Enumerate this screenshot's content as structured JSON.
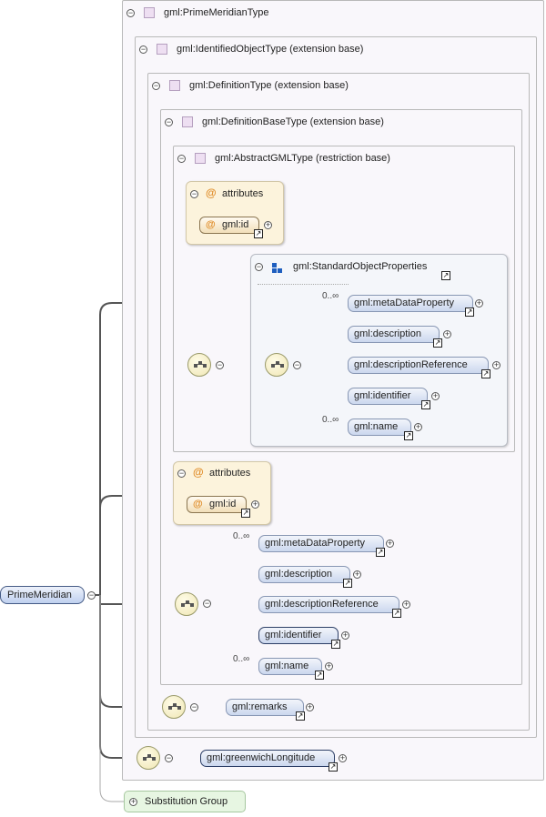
{
  "types": {
    "prime_meridian_type": "gml:PrimeMeridianType",
    "identified_object_type": "gml:IdentifiedObjectType (extension base)",
    "definition_type": "gml:DefinitionType (extension base)",
    "definition_base_type": "gml:DefinitionBaseType (extension base)",
    "abstract_gml_type": "gml:AbstractGMLType (restriction base)"
  },
  "attributes_label": "attributes",
  "attribute_id": "gml:id",
  "group_name": "gml:StandardObjectProperties",
  "cardinality": "0..∞",
  "group_elements": [
    "gml:metaDataProperty",
    "gml:description",
    "gml:descriptionReference",
    "gml:identifier",
    "gml:name"
  ],
  "definition_elements": [
    "gml:metaDataProperty",
    "gml:description",
    "gml:descriptionReference",
    "gml:identifier",
    "gml:name"
  ],
  "remarks": "gml:remarks",
  "greenwich": "gml:greenwichLongitude",
  "root": "PrimeMeridian",
  "substitution_group": "Substitution Group",
  "colors": {
    "type_box": "#f9f7fb",
    "attributes_box": "#fcf3dc",
    "element_fill": "#cbd7ee",
    "substitution_fill": "#e7f6e2"
  }
}
